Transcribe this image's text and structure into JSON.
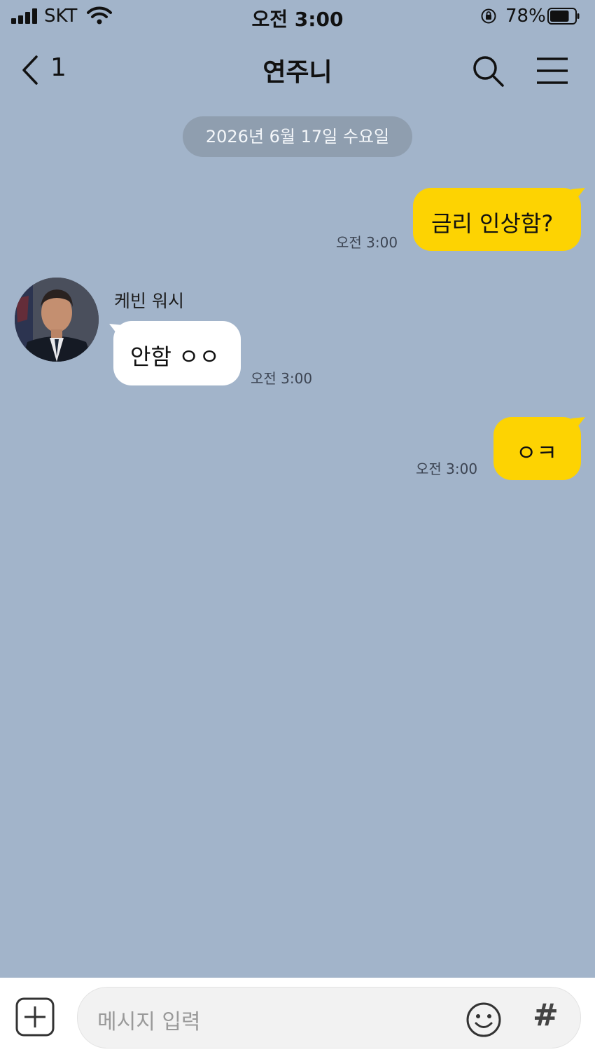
{
  "status_bar": {
    "carrier": "SKT",
    "time": "오전 3:00",
    "battery_percent": "78%",
    "battery_level": 0.78
  },
  "header": {
    "back_count": "1",
    "title": "연주니"
  },
  "date_divider": "2026년 6월 17일 수요일",
  "messages": [
    {
      "side": "me",
      "text": "금리 인상함?",
      "time": "오전 3:00"
    },
    {
      "side": "them",
      "sender": "케빈 워시",
      "text": "안함 ㅇㅇ",
      "time": "오전 3:00"
    },
    {
      "side": "me",
      "text": "ㅇㅋ",
      "time": "오전 3:00"
    }
  ],
  "input": {
    "placeholder": "메시지 입력",
    "hash_label": "#"
  },
  "colors": {
    "chat_background": "#a2b4ca",
    "my_bubble": "#fdd302",
    "their_bubble": "#ffffff",
    "date_pill": "#8f9eaf"
  },
  "icons": [
    "signal-icon",
    "wifi-icon",
    "orientation-lock-icon",
    "battery-icon",
    "back-chevron-icon",
    "search-icon",
    "menu-icon",
    "plus-icon",
    "emoji-icon",
    "hash-icon"
  ]
}
